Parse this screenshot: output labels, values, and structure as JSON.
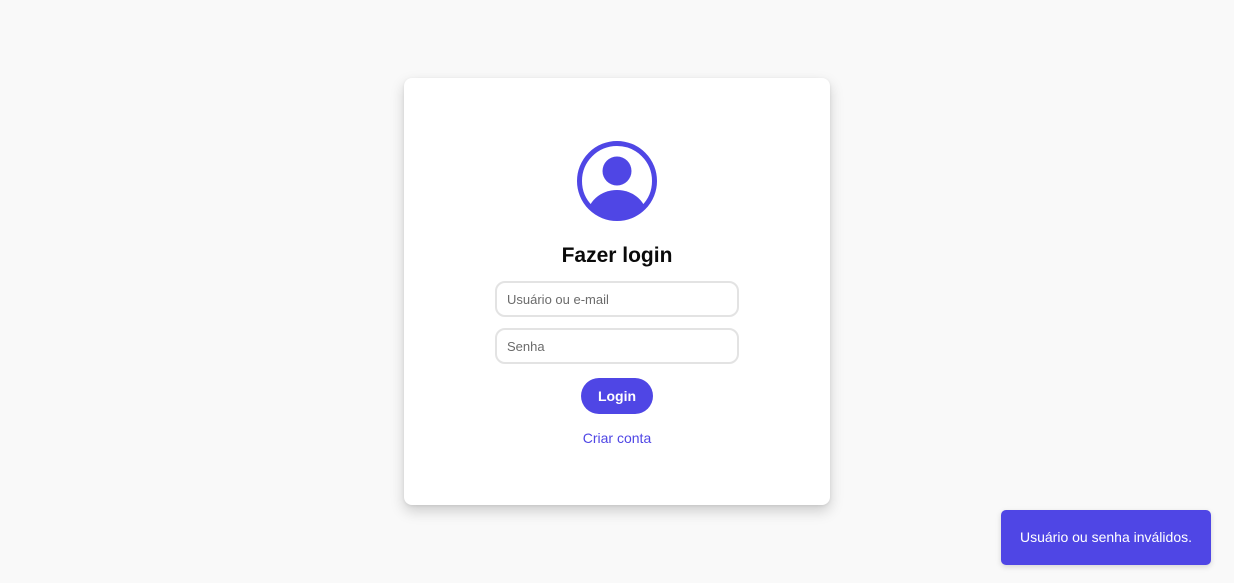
{
  "login": {
    "avatar_icon": "user-circle-icon",
    "title": "Fazer login",
    "username_placeholder": "Usuário ou e-mail",
    "username_value": "",
    "password_placeholder": "Senha",
    "password_value": "",
    "submit_label": "Login",
    "create_account_label": "Criar conta"
  },
  "toast": {
    "message": "Usuário ou senha inválidos."
  },
  "colors": {
    "accent": "#4f46e5",
    "background": "#f9f9f9",
    "card": "#ffffff",
    "title_text": "#0a0a0a"
  }
}
